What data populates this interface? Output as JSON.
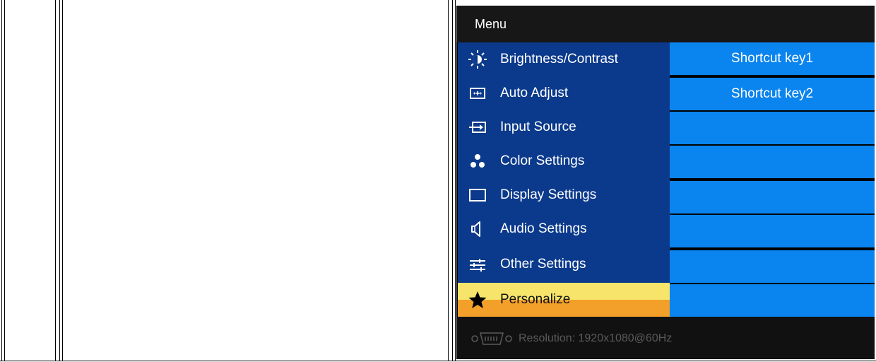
{
  "osd": {
    "title": "Menu",
    "menu_items": [
      {
        "label": "Brightness/Contrast",
        "icon": "brightness-icon"
      },
      {
        "label": "Auto Adjust",
        "icon": "auto-adjust-icon"
      },
      {
        "label": "Input Source",
        "icon": "input-source-icon"
      },
      {
        "label": "Color Settings",
        "icon": "color-settings-icon"
      },
      {
        "label": "Display Settings",
        "icon": "display-settings-icon"
      },
      {
        "label": "Audio Settings",
        "icon": "speaker-icon"
      },
      {
        "label": "Other Settings",
        "icon": "sliders-icon"
      },
      {
        "label": "Personalize",
        "icon": "star-icon",
        "selected": true
      }
    ],
    "right_cells": [
      "Shortcut key1",
      "Shortcut key2",
      "",
      "",
      "",
      "",
      "",
      ""
    ],
    "resolution_text": "Resolution:  1920x1080@60Hz",
    "colors": {
      "menu_bg": "#0b3a8c",
      "cell_bg": "#0a84ee",
      "selected_top": "#f6e56a",
      "selected_bottom": "#f2a02a"
    }
  }
}
